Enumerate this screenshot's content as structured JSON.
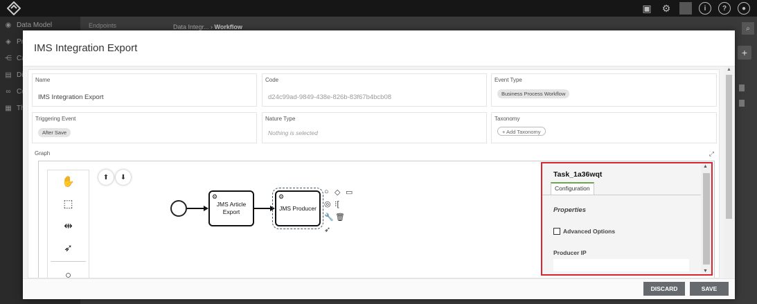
{
  "background": {
    "nav_items": [
      {
        "label": "Data Model",
        "icon": "database-icon"
      },
      {
        "label": "Pr",
        "icon": "shield-icon"
      },
      {
        "label": "Ca",
        "icon": "share-icon"
      },
      {
        "label": "Di",
        "icon": "document-icon"
      },
      {
        "label": "Co",
        "icon": "link-icon"
      },
      {
        "label": "Th",
        "icon": "layers-icon"
      }
    ],
    "sub_label": "Endpoints",
    "breadcrumb": [
      "Data Integr...",
      "Workflow"
    ]
  },
  "modal": {
    "title": "IMS Integration Export",
    "fields": {
      "name": {
        "label": "Name",
        "value": "IMS Integration Export"
      },
      "code": {
        "label": "Code",
        "value": "d24c99ad-9849-438e-826b-83f67b4bcb08"
      },
      "event_type": {
        "label": "Event Type",
        "value": "Business Process Workflow"
      },
      "triggering_event": {
        "label": "Triggering Event",
        "value": "After Save"
      },
      "nature_type": {
        "label": "Nature Type",
        "placeholder": "Nothing is selected"
      },
      "taxonomy": {
        "label": "Taxonomy",
        "add_label": "+ Add Taxonomy"
      }
    },
    "graph": {
      "label": "Graph",
      "tasks": [
        {
          "label": "JMS Article Export"
        },
        {
          "label": "JMS Producer"
        }
      ],
      "palette": [
        "hand-tool-icon",
        "lasso-tool-icon",
        "space-tool-icon",
        "connect-tool-icon",
        "start-event-icon"
      ]
    },
    "properties": {
      "title": "Task_1a36wqt",
      "tab": "Configuration",
      "section": "Properties",
      "advanced_options": "Advanced Options",
      "producer_ip_label": "Producer IP",
      "producer_ip_value": ""
    },
    "footer": {
      "discard": "DISCARD",
      "save": "SAVE"
    }
  },
  "colors": {
    "highlight": "#d9232d",
    "tab_accent": "#6aa84f",
    "button": "#666a6e"
  }
}
